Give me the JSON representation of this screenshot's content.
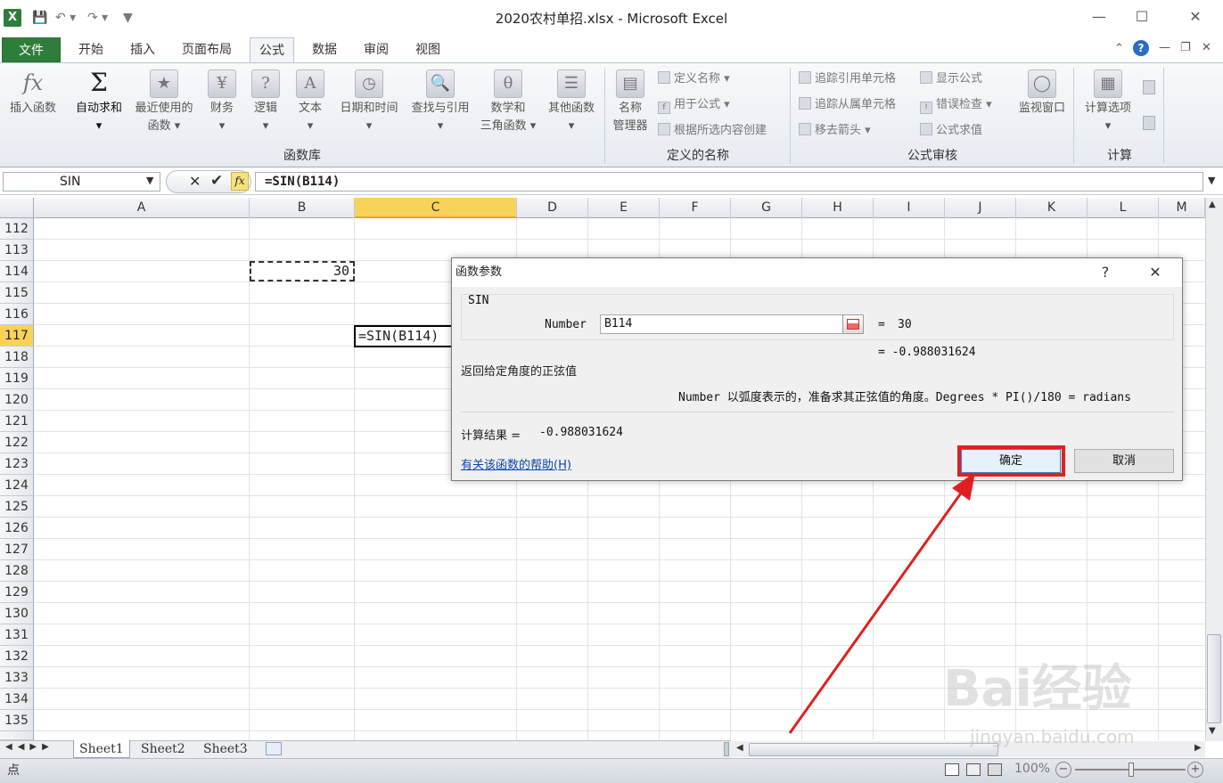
{
  "window": {
    "title": "2020农村单招.xlsx - Microsoft Excel",
    "minimize_icon": "minimize-icon",
    "maximize_icon": "maximize-icon",
    "close_icon": "close-icon"
  },
  "ribbon_tabs": [
    "文件",
    "开始",
    "插入",
    "页面布局",
    "公式",
    "数据",
    "审阅",
    "视图"
  ],
  "active_tab": "公式",
  "ribbon": {
    "function_library": {
      "label": "函数库",
      "insert_function": "插入函数",
      "autosum": "自动求和",
      "recent_1": "最近使用的",
      "recent_2": "函数",
      "financial": "财务",
      "logical": "逻辑",
      "text": "文本",
      "datetime": "日期和时间",
      "lookup": "查找与引用",
      "math_1": "数学和",
      "math_2": "三角函数",
      "more": "其他函数"
    },
    "defined_names": {
      "label": "定义的名称",
      "name_manager_1": "名称",
      "name_manager_2": "管理器",
      "define_name": "定义名称",
      "use_in_formula": "用于公式",
      "create_from_selection": "根据所选内容创建"
    },
    "formula_auditing": {
      "label": "公式审核",
      "trace_precedents": "追踪引用单元格",
      "trace_dependents": "追踪从属单元格",
      "remove_arrows": "移去箭头",
      "show_formulas": "显示公式",
      "error_checking": "错误检查",
      "evaluate_formula": "公式求值",
      "watch_window": "监视窗口"
    },
    "calculation": {
      "label": "计算",
      "options": "计算选项"
    }
  },
  "formula_bar": {
    "name_box": "SIN",
    "formula": "=SIN(B114)"
  },
  "grid": {
    "columns": [
      "A",
      "B",
      "C",
      "D",
      "E",
      "F",
      "G",
      "H",
      "I",
      "J",
      "K",
      "L",
      "M"
    ],
    "selected_column": "C",
    "rows": [
      "112",
      "113",
      "114",
      "115",
      "116",
      "117",
      "118",
      "119",
      "120",
      "121",
      "122",
      "123",
      "124",
      "125",
      "126",
      "127",
      "128",
      "129",
      "130",
      "131",
      "132",
      "133",
      "134",
      "135"
    ],
    "selected_row": "117",
    "cell_B114": "30",
    "cell_C117": "=SIN(B114)"
  },
  "dialog": {
    "title": "函数参数",
    "help_glyph": "?",
    "close_glyph": "✕",
    "function_name": "SIN",
    "arg_label": "Number",
    "arg_value": "B114",
    "arg_eq": "=",
    "arg_result": "30",
    "result_line": "=  -0.988031624",
    "description": "返回给定角度的正弦值",
    "arg_description": "Number  以弧度表示的，准备求其正弦值的角度。Degrees * PI()/180 = radians",
    "calc_result_label": "计算结果 =",
    "calc_result_value": "-0.988031624",
    "help_link": "有关该函数的帮助(H)",
    "ok": "确定",
    "cancel": "取消"
  },
  "sheets": [
    "Sheet1",
    "Sheet2",
    "Sheet3"
  ],
  "active_sheet": "Sheet1",
  "status": {
    "mode": "点",
    "zoom": "100%"
  },
  "watermark": {
    "brand": "Bai经验",
    "url": "jingyan.baidu.com"
  },
  "colors": {
    "excel_green": "#2f7d3a",
    "selection_yellow": "#f8d35a",
    "highlight_red": "#e02020"
  }
}
